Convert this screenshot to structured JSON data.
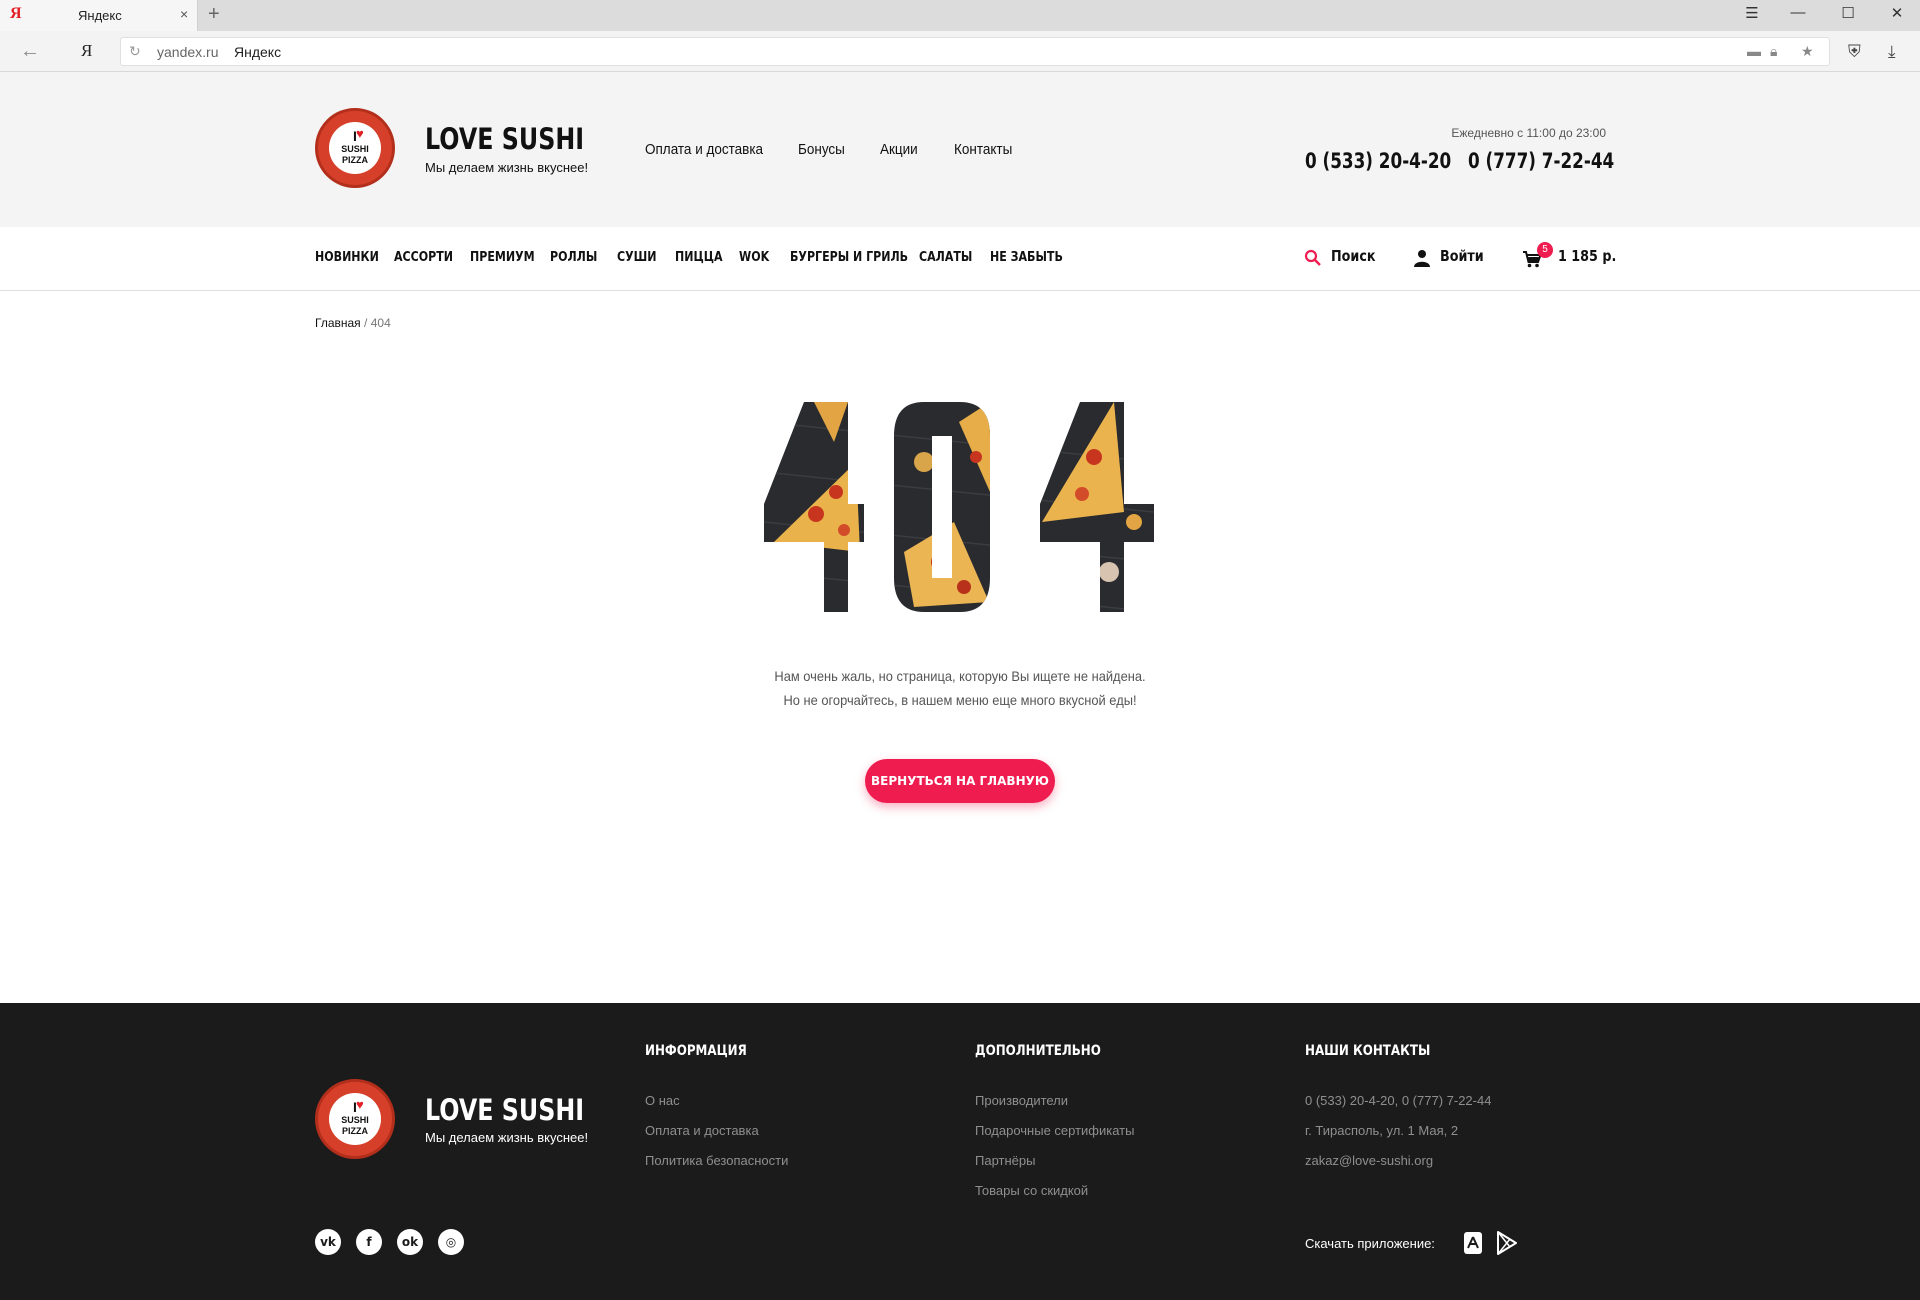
{
  "browser": {
    "tab_title": "Яндекс",
    "tab_ya": "Я",
    "tab_close": "×",
    "new_tab": "+",
    "address_ya": "Я",
    "url_host": "yandex.ru",
    "url_title": "Яндекс"
  },
  "header": {
    "brand": "LOVE SUSHI",
    "tagline": "Мы делаем жизнь вкуснее!",
    "logo_text": [
      "I",
      "SUSHI",
      "PIZZA"
    ],
    "nav": [
      "Оплата и доставка",
      "Бонусы",
      "Акции",
      "Контакты"
    ],
    "hours": "Ежедневно с 11:00 до 23:00",
    "phones": [
      "0 (533) 20-4-20",
      "0 (777) 7-22-44"
    ]
  },
  "categories": [
    "НОВИНКИ",
    "АССОРТИ",
    "ПРЕМИУМ",
    "РОЛЛЫ",
    "СУШИ",
    "ПИЦЦА",
    "WOK",
    "БУРГЕРЫ И ГРИЛЬ",
    "САЛАТЫ",
    "НЕ ЗАБЫТЬ"
  ],
  "utility": {
    "search_label": "Поиск",
    "login_label": "Войти",
    "cart_count": "5",
    "cart_total": "1 185 р."
  },
  "breadcrumb": {
    "home": "Главная",
    "separator": "/",
    "current": "404"
  },
  "error": {
    "code": "404",
    "line1": "Нам очень жаль, но страница, которую Вы ищете не найдена.",
    "line2": "Но не огорчайтесь, в нашем меню еще много вкусной еды!",
    "button": "ВЕРНУТЬСЯ НА ГЛАВНУЮ"
  },
  "footer": {
    "brand": "LOVE SUSHI",
    "tagline": "Мы делаем жизнь вкуснее!",
    "info_title": "ИНФОРМАЦИЯ",
    "info_links": [
      "О нас",
      "Оплата и доставка",
      "Политика безопасности"
    ],
    "extra_title": "ДОПОЛНИТЕЛЬНО",
    "extra_links": [
      "Производители",
      "Подарочные сертификаты",
      "Партнёры",
      "Товары со скидкой"
    ],
    "contacts_title": "НАШИ КОНТАКТЫ",
    "contacts": [
      "0 (533) 20-4-20, 0 (777) 7-22-44",
      "г. Тирасполь, ул. 1 Мая, 2",
      "zakaz@love-sushi.org"
    ],
    "app_label": "Скачать приложение:",
    "social_icons": [
      "vk-icon",
      "facebook-icon",
      "odnoklassniki-icon",
      "instagram-icon"
    ],
    "store_icons": [
      "app-store-icon",
      "google-play-icon"
    ]
  },
  "colors": {
    "accent": "#ef1c4f",
    "header_bg": "#f4f4f5",
    "footer_bg": "#1b1b1c"
  }
}
